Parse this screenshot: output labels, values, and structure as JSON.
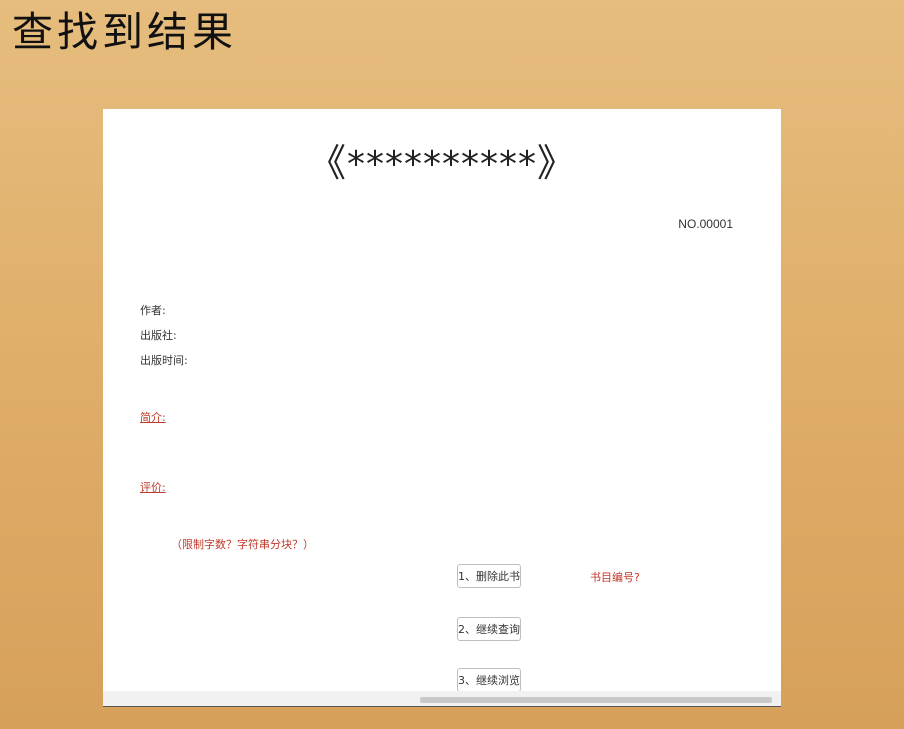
{
  "slide_title": "查找到结果",
  "book": {
    "open_bracket": "《",
    "title": "**********",
    "close_bracket": "》",
    "number": "NO.00001"
  },
  "meta": {
    "author_label": "作者:",
    "publisher_label": "出版社:",
    "publish_time_label": "出版时间:"
  },
  "sections": {
    "intro_label": "简介:",
    "review_label": "评价:"
  },
  "notes": {
    "limit_note": "（限制字数？字符串分块？）",
    "catalog_note": "书目编号?"
  },
  "actions": {
    "delete_label": "1、删除此书",
    "continue_search_label": "2、继续查询",
    "continue_browse_label": "3、继续浏览"
  }
}
